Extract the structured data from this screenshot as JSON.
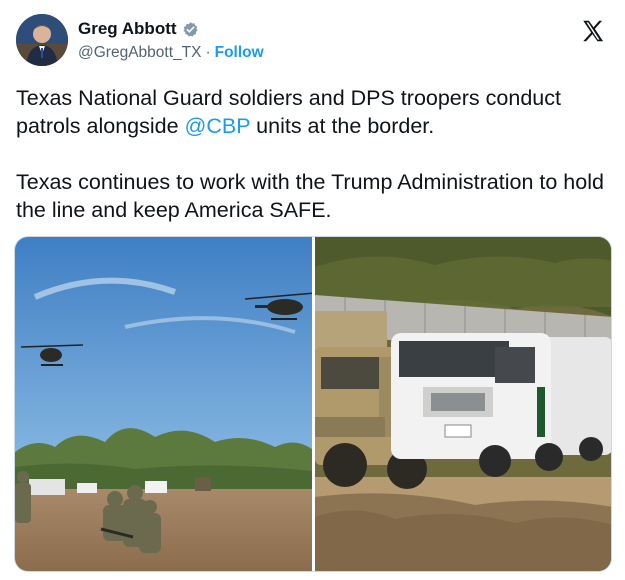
{
  "author": {
    "display_name": "Greg Abbott",
    "handle": "@GregAbbott_TX",
    "separator": "·",
    "follow_label": "Follow",
    "verified_icon": "verified-badge-icon"
  },
  "brand": {
    "logo_icon": "x-logo-icon"
  },
  "post": {
    "paragraph1_before": "Texas National Guard soldiers and DPS troopers conduct patrols alongside ",
    "mention": "@CBP",
    "paragraph1_after": " units at the border.",
    "paragraph2": "Texas continues to work with the Trump Administration to hold the line and keep America SAFE."
  },
  "colors": {
    "link": "#1d9bf0",
    "text": "#0f1419",
    "secondary": "#536471",
    "verified": "#829aab"
  }
}
